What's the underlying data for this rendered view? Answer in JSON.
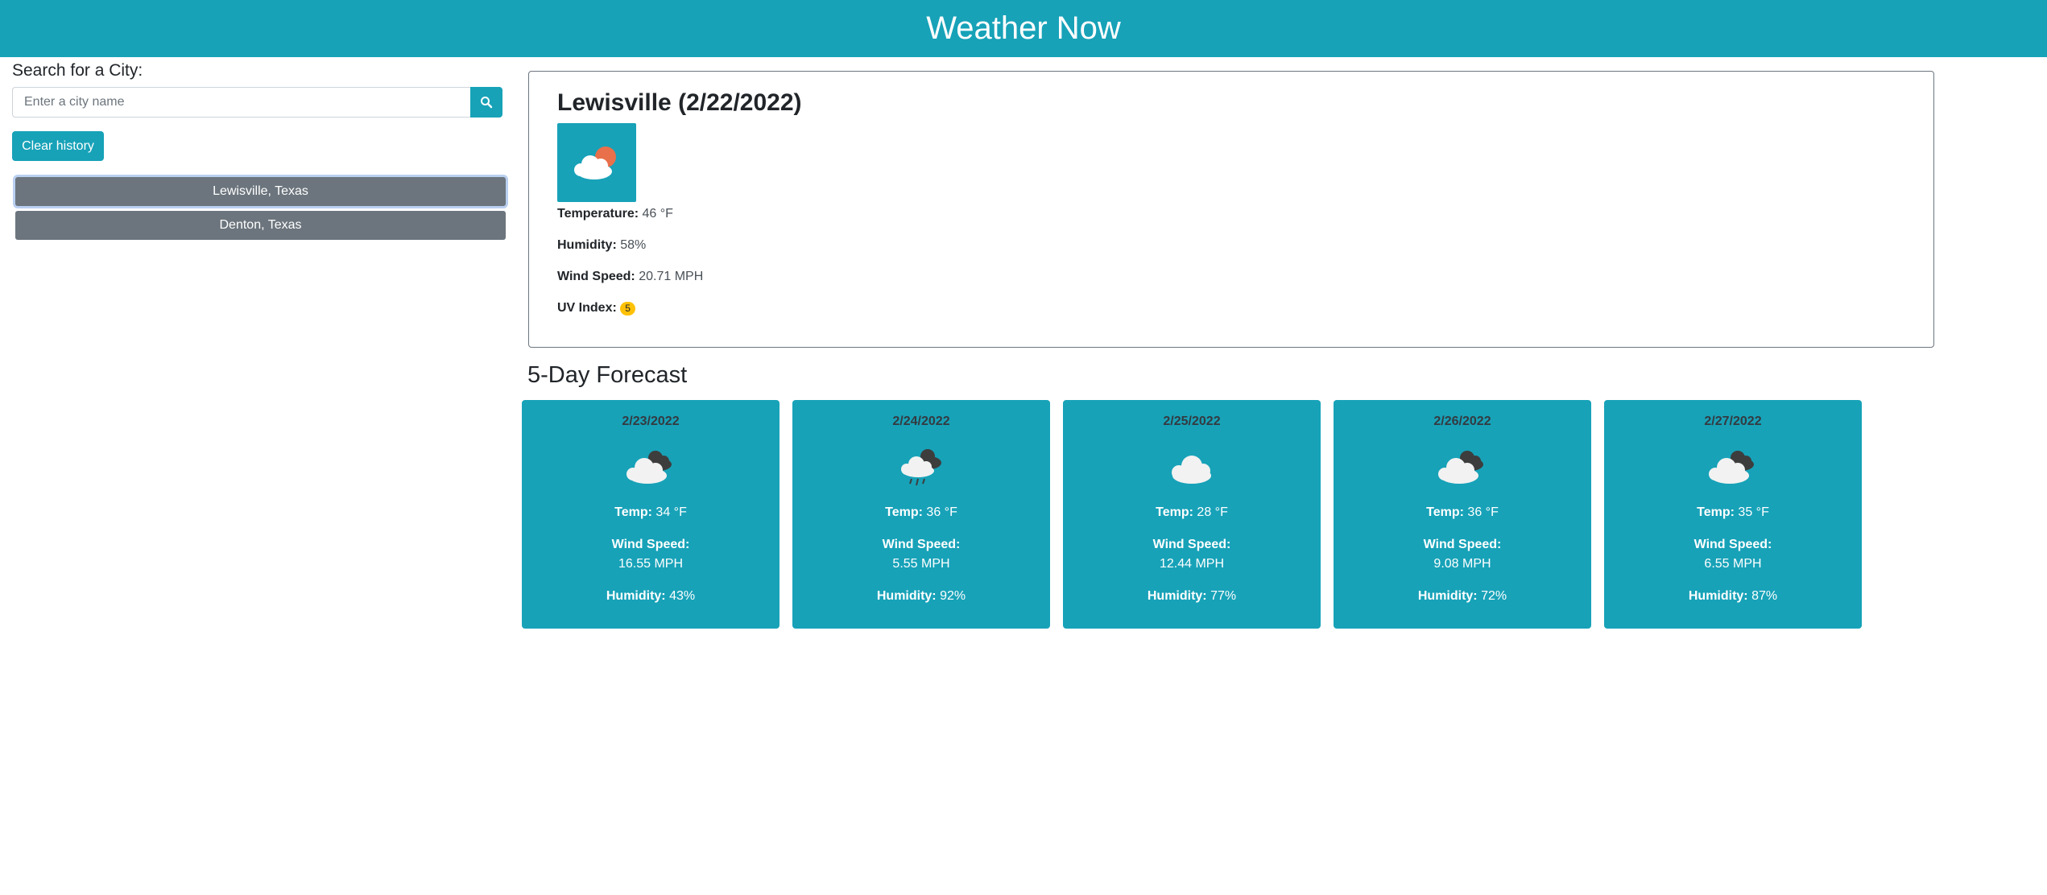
{
  "header": {
    "title": "Weather Now"
  },
  "search": {
    "label": "Search for a City:",
    "placeholder": "Enter a city name",
    "icon": "search-icon",
    "clear_label": "Clear history"
  },
  "history": [
    {
      "label": "Lewisville, Texas"
    },
    {
      "label": "Denton, Texas"
    }
  ],
  "current": {
    "title": "Lewisville (2/22/2022)",
    "icon": "partly-cloudy-day-icon",
    "temperature_label": "Temperature:",
    "temperature": "46 °F",
    "humidity_label": "Humidity:",
    "humidity": "58%",
    "wind_label": "Wind Speed:",
    "wind": "20.71 MPH",
    "uv_label": "UV Index:",
    "uv": "5"
  },
  "forecast": {
    "title": "5-Day Forecast",
    "temp_label": "Temp:",
    "wind_label": "Wind Speed:",
    "humidity_label": "Humidity:",
    "days": [
      {
        "date": "2/23/2022",
        "icon": "broken-clouds-icon",
        "temp": "34 °F",
        "wind": "16.55 MPH",
        "humidity": "43%"
      },
      {
        "date": "2/24/2022",
        "icon": "rain-icon",
        "temp": "36 °F",
        "wind": "5.55 MPH",
        "humidity": "92%"
      },
      {
        "date": "2/25/2022",
        "icon": "cloud-icon",
        "temp": "28 °F",
        "wind": "12.44 MPH",
        "humidity": "77%"
      },
      {
        "date": "2/26/2022",
        "icon": "broken-clouds-icon",
        "temp": "36 °F",
        "wind": "9.08 MPH",
        "humidity": "72%"
      },
      {
        "date": "2/27/2022",
        "icon": "broken-clouds-icon",
        "temp": "35 °F",
        "wind": "6.55 MPH",
        "humidity": "87%"
      }
    ]
  },
  "colors": {
    "accent": "#17a2b8",
    "history_button": "#6c757d",
    "uv_badge": "#ffc107"
  }
}
